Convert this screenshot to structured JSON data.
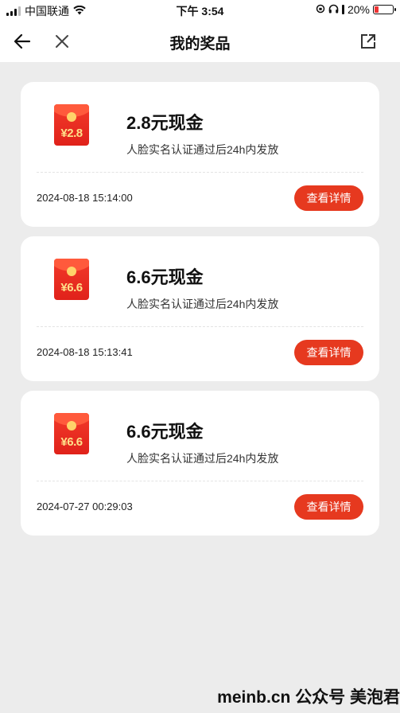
{
  "status": {
    "carrier": "中国联通",
    "time": "下午 3:54",
    "battery_pct": "20%"
  },
  "nav": {
    "title": "我的奖品",
    "back_icon": "arrow-left-icon",
    "close_icon": "close-icon",
    "share_icon": "external-link-icon"
  },
  "prizes": [
    {
      "envelope_amount": "¥2.8",
      "title": "2.8元现金",
      "desc": "人脸实名认证通过后24h内发放",
      "time": "2024-08-18 15:14:00",
      "button": "查看详情"
    },
    {
      "envelope_amount": "¥6.6",
      "title": "6.6元现金",
      "desc": "人脸实名认证通过后24h内发放",
      "time": "2024-08-18 15:13:41",
      "button": "查看详情"
    },
    {
      "envelope_amount": "¥6.6",
      "title": "6.6元现金",
      "desc": "人脸实名认证通过后24h内发放",
      "time": "2024-07-27 00:29:03",
      "button": "查看详情"
    }
  ],
  "watermark": "meinb.cn  公众号 美泡君",
  "colors": {
    "accent": "#e6391f",
    "background": "#ececec"
  }
}
